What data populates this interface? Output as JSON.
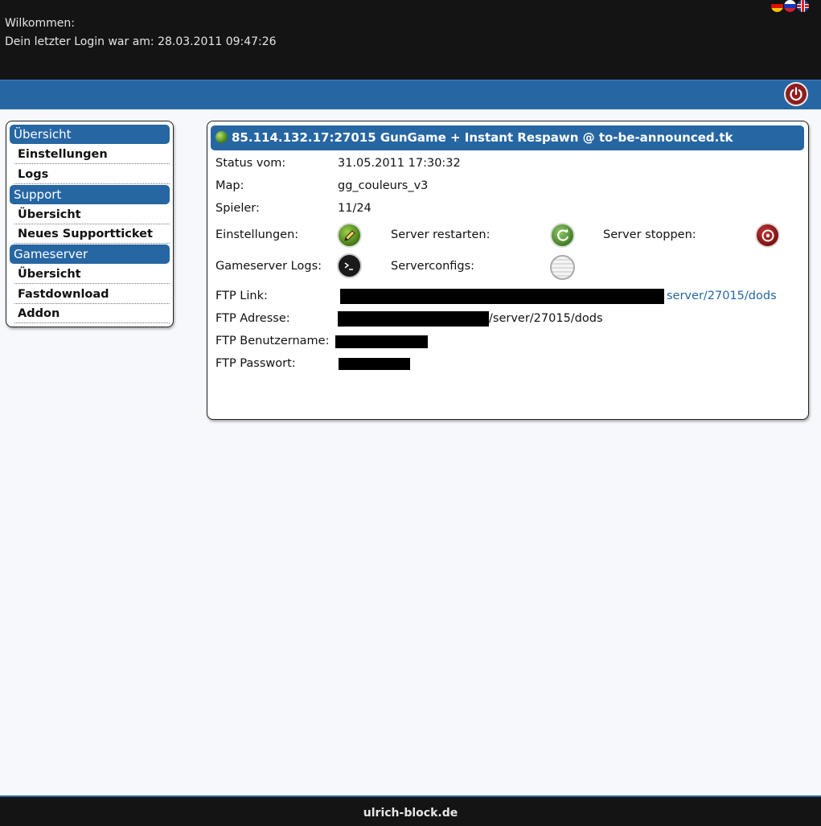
{
  "header": {
    "welcome": "Wilkommen:",
    "last_login": "Dein letzter Login war am: 28.03.2011 09:47:26",
    "flags": [
      "de-flag-icon",
      "ru-flag-icon",
      "uk-flag-icon"
    ]
  },
  "nav": {
    "power_icon": "power-icon"
  },
  "sidebar": {
    "sections": [
      {
        "title": "Übersicht",
        "items": [
          "Einstellungen",
          "Logs"
        ]
      },
      {
        "title": "Support",
        "items": [
          "Übersicht",
          "Neues Supportticket"
        ]
      },
      {
        "title": "Gameserver",
        "items": [
          "Übersicht",
          "Fastdownload",
          "Addon"
        ]
      }
    ]
  },
  "server": {
    "title": "85.114.132.17:27015 GunGame + Instant Respawn @ to-be-announced.tk",
    "status_label": "Status vom:",
    "status_value": "31.05.2011 17:30:32",
    "map_label": "Map:",
    "map_value": "gg_couleurs_v3",
    "players_label": "Spieler:",
    "players_value": "11/24",
    "settings_label": "Einstellungen:",
    "restart_label": "Server restarten:",
    "stop_label": "Server stoppen:",
    "logs_label": "Gameserver Logs:",
    "configs_label": "Serverconfigs:",
    "ftp_link_label": "FTP Link:",
    "ftp_link_suffix": "server/27015/dods",
    "ftp_address_label": "FTP Adresse:",
    "ftp_address_suffix": "/server/27015/dods",
    "ftp_user_label": "FTP Benutzername:",
    "ftp_password_label": "FTP Passwort:"
  },
  "footer": {
    "text": "ulrich-block.de"
  },
  "colors": {
    "accent": "#2666a3",
    "header_bg": "#141414",
    "page_bg": "#f7f8fb"
  }
}
